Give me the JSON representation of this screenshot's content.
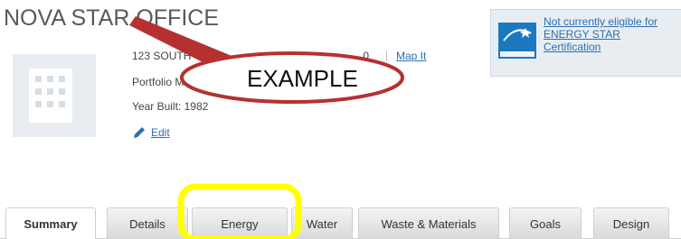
{
  "building": {
    "title": "NOVA STAR OFFICE",
    "address": "123 SOUTH",
    "address_tail": "0 ",
    "map_link": "Map It",
    "portfolio_label": "Portfolio Man",
    "year_built": "Year Built: 1982",
    "edit_label": "Edit"
  },
  "energy_star": {
    "line1": "Not currently eligible for",
    "line2": "ENERGY STAR",
    "line3": "Certification",
    "logo_icon": "energy-star-logo",
    "brand_color": "#1c79c0"
  },
  "tabs": [
    {
      "label": "Summary",
      "active": true
    },
    {
      "label": "Details",
      "active": false
    },
    {
      "label": "Energy",
      "active": false
    },
    {
      "label": "Water",
      "active": false
    },
    {
      "label": "Waste & Materials",
      "active": false
    },
    {
      "label": "Goals",
      "active": false
    },
    {
      "label": "Design",
      "active": false
    }
  ],
  "annotation": {
    "label": "EXAMPLE",
    "arrow_color": "#b5312f",
    "highlight_color": "#ffff00"
  },
  "colors": {
    "link": "#2d6fb0",
    "title": "#555a5e"
  }
}
